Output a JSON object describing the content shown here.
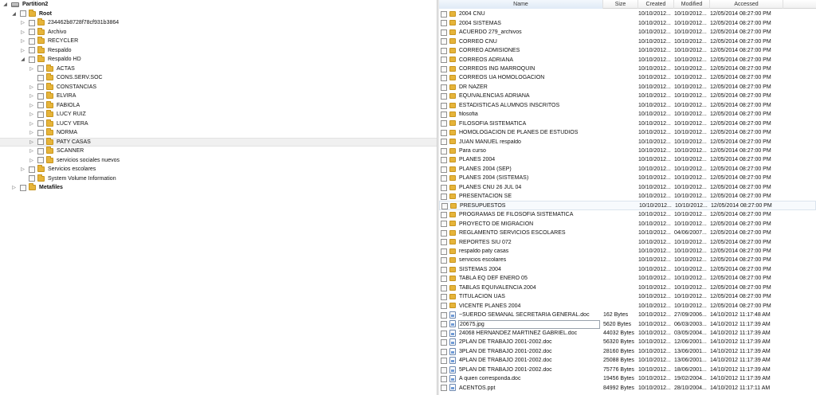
{
  "tree": [
    {
      "label": "Partition2",
      "level": 0,
      "expander": "◢",
      "icon": "drive-icon",
      "bold": true,
      "checkbox": false
    },
    {
      "label": "Root",
      "level": 1,
      "expander": "◢",
      "icon": "folder-icon",
      "bold": true
    },
    {
      "label": "234462b8728f78cf931b3864",
      "level": 2,
      "expander": "▷",
      "icon": "folder-icon"
    },
    {
      "label": "Archivo",
      "level": 2,
      "expander": "▷",
      "icon": "folder-icon"
    },
    {
      "label": "RECYCLER",
      "level": 2,
      "expander": "▷",
      "icon": "folder-icon"
    },
    {
      "label": "Respaldo",
      "level": 2,
      "expander": "▷",
      "icon": "folder-icon"
    },
    {
      "label": "Respaldo HD",
      "level": 2,
      "expander": "◢",
      "icon": "folder-icon"
    },
    {
      "label": "ACTAS",
      "level": 3,
      "expander": "▷",
      "icon": "folder-icon"
    },
    {
      "label": "CONS.SERV.SOC",
      "level": 3,
      "expander": "",
      "icon": "folder-icon"
    },
    {
      "label": "CONSTANCIAS",
      "level": 3,
      "expander": "▷",
      "icon": "folder-icon"
    },
    {
      "label": "ELVIRA",
      "level": 3,
      "expander": "▷",
      "icon": "folder-icon"
    },
    {
      "label": "FABIOLA",
      "level": 3,
      "expander": "▷",
      "icon": "folder-icon"
    },
    {
      "label": "LUCY RUIZ",
      "level": 3,
      "expander": "▷",
      "icon": "folder-icon"
    },
    {
      "label": "LUCY VERA",
      "level": 3,
      "expander": "▷",
      "icon": "folder-icon"
    },
    {
      "label": "NORMA",
      "level": 3,
      "expander": "▷",
      "icon": "folder-icon"
    },
    {
      "label": "PATY CASAS",
      "level": 3,
      "expander": "▷",
      "icon": "folder-icon",
      "selected": true
    },
    {
      "label": "SCANNER",
      "level": 3,
      "expander": "▷",
      "icon": "folder-icon"
    },
    {
      "label": "servicios sociales nuevos",
      "level": 3,
      "expander": "▷",
      "icon": "folder-icon"
    },
    {
      "label": "Servicios escolares",
      "level": 2,
      "expander": "▷",
      "icon": "folder-icon"
    },
    {
      "label": "System Volume Information",
      "level": 2,
      "expander": "",
      "icon": "folder-icon"
    },
    {
      "label": "Metafiles",
      "level": 1,
      "expander": "▷",
      "icon": "folder-icon",
      "bold": true
    }
  ],
  "list": {
    "headers": {
      "name": "Name",
      "size": "Size",
      "created": "Created",
      "modified": "Modified",
      "accessed": "Accessed"
    },
    "rows": [
      {
        "name": "2004 CNU",
        "size": "",
        "created": "10/10/2012...",
        "modified": "10/10/2012...",
        "accessed": "12/05/2014 08:27:00 PM",
        "type": "folder"
      },
      {
        "name": "2004 SISTEMAS",
        "size": "",
        "created": "10/10/2012...",
        "modified": "10/10/2012...",
        "accessed": "12/05/2014 08:27:00 PM",
        "type": "folder"
      },
      {
        "name": "ACUERDO 279_archivos",
        "size": "",
        "created": "10/10/2012...",
        "modified": "10/10/2012...",
        "accessed": "12/05/2014 08:27:00 PM",
        "type": "folder"
      },
      {
        "name": "CORREO CNU",
        "size": "",
        "created": "10/10/2012...",
        "modified": "10/10/2012...",
        "accessed": "12/05/2014 08:27:00 PM",
        "type": "folder"
      },
      {
        "name": "CORREO ADMISIONES",
        "size": "",
        "created": "10/10/2012...",
        "modified": "10/10/2012...",
        "accessed": "12/05/2014 08:27:00 PM",
        "type": "folder"
      },
      {
        "name": "CORREOS ADRIANA",
        "size": "",
        "created": "10/10/2012...",
        "modified": "10/10/2012...",
        "accessed": "12/05/2014 08:27:00 PM",
        "type": "folder"
      },
      {
        "name": "CORREOS ING MARROQUIN",
        "size": "",
        "created": "10/10/2012...",
        "modified": "10/10/2012...",
        "accessed": "12/05/2014 08:27:00 PM",
        "type": "folder"
      },
      {
        "name": "CORREOS UA HOMOLOGACION",
        "size": "",
        "created": "10/10/2012...",
        "modified": "10/10/2012...",
        "accessed": "12/05/2014 08:27:00 PM",
        "type": "folder"
      },
      {
        "name": "DR NAZER",
        "size": "",
        "created": "10/10/2012...",
        "modified": "10/10/2012...",
        "accessed": "12/05/2014 08:27:00 PM",
        "type": "folder"
      },
      {
        "name": "EQUIVALENCIAS ADRIANA",
        "size": "",
        "created": "10/10/2012...",
        "modified": "10/10/2012...",
        "accessed": "12/05/2014 08:27:00 PM",
        "type": "folder"
      },
      {
        "name": "ESTADISTICAS ALUMNOS INSCRITOS",
        "size": "",
        "created": "10/10/2012...",
        "modified": "10/10/2012...",
        "accessed": "12/05/2014 08:27:00 PM",
        "type": "folder"
      },
      {
        "name": "filosofia",
        "size": "",
        "created": "10/10/2012...",
        "modified": "10/10/2012...",
        "accessed": "12/05/2014 08:27:00 PM",
        "type": "folder"
      },
      {
        "name": "FILOSOFIA SISTEMATICA",
        "size": "",
        "created": "10/10/2012...",
        "modified": "10/10/2012...",
        "accessed": "12/05/2014 08:27:00 PM",
        "type": "folder"
      },
      {
        "name": "HOMOLOGACION DE PLANES DE ESTUDIOS",
        "size": "",
        "created": "10/10/2012...",
        "modified": "10/10/2012...",
        "accessed": "12/05/2014 08:27:00 PM",
        "type": "folder"
      },
      {
        "name": "JUAN MANUEL respaldo",
        "size": "",
        "created": "10/10/2012...",
        "modified": "10/10/2012...",
        "accessed": "12/05/2014 08:27:00 PM",
        "type": "folder"
      },
      {
        "name": "Para curso",
        "size": "",
        "created": "10/10/2012...",
        "modified": "10/10/2012...",
        "accessed": "12/05/2014 08:27:00 PM",
        "type": "folder"
      },
      {
        "name": "PLANES 2004",
        "size": "",
        "created": "10/10/2012...",
        "modified": "10/10/2012...",
        "accessed": "12/05/2014 08:27:00 PM",
        "type": "folder"
      },
      {
        "name": "PLANES 2004 (SEP)",
        "size": "",
        "created": "10/10/2012...",
        "modified": "10/10/2012...",
        "accessed": "12/05/2014 08:27:00 PM",
        "type": "folder"
      },
      {
        "name": "PLANES 2004 (SISTEMAS)",
        "size": "",
        "created": "10/10/2012...",
        "modified": "10/10/2012...",
        "accessed": "12/05/2014 08:27:00 PM",
        "type": "folder"
      },
      {
        "name": "PLANES CNU 26 JUL 04",
        "size": "",
        "created": "10/10/2012...",
        "modified": "10/10/2012...",
        "accessed": "12/05/2014 08:27:00 PM",
        "type": "folder"
      },
      {
        "name": "PRESENTACION SE",
        "size": "",
        "created": "10/10/2012...",
        "modified": "10/10/2012...",
        "accessed": "12/05/2014 08:27:00 PM",
        "type": "folder"
      },
      {
        "name": "PRESUPUESTOS",
        "size": "",
        "created": "10/10/2012...",
        "modified": "10/10/2012...",
        "accessed": "12/05/2014 08:27:00 PM",
        "type": "folder",
        "selected": true
      },
      {
        "name": "PROGRAMAS DE FILOSOFIA SISTEMATICA",
        "size": "",
        "created": "10/10/2012...",
        "modified": "10/10/2012...",
        "accessed": "12/05/2014 08:27:00 PM",
        "type": "folder"
      },
      {
        "name": "PROYECTO DE MIGRACION",
        "size": "",
        "created": "10/10/2012...",
        "modified": "10/10/2012...",
        "accessed": "12/05/2014 08:27:00 PM",
        "type": "folder"
      },
      {
        "name": "REGLAMENTO SERVICIOS ESCOLARES",
        "size": "",
        "created": "10/10/2012...",
        "modified": "04/06/2007...",
        "accessed": "12/05/2014 08:27:00 PM",
        "type": "folder"
      },
      {
        "name": "REPORTES SIU 072",
        "size": "",
        "created": "10/10/2012...",
        "modified": "10/10/2012...",
        "accessed": "12/05/2014 08:27:00 PM",
        "type": "folder"
      },
      {
        "name": "respaldo paty casas",
        "size": "",
        "created": "10/10/2012...",
        "modified": "10/10/2012...",
        "accessed": "12/05/2014 08:27:00 PM",
        "type": "folder"
      },
      {
        "name": "servicios escolares",
        "size": "",
        "created": "10/10/2012...",
        "modified": "10/10/2012...",
        "accessed": "12/05/2014 08:27:00 PM",
        "type": "folder"
      },
      {
        "name": "SISTEMAS 2004",
        "size": "",
        "created": "10/10/2012...",
        "modified": "10/10/2012...",
        "accessed": "12/05/2014 08:27:00 PM",
        "type": "folder"
      },
      {
        "name": "TABLA EQ DEF ENERO 05",
        "size": "",
        "created": "10/10/2012...",
        "modified": "10/10/2012...",
        "accessed": "12/05/2014 08:27:00 PM",
        "type": "folder"
      },
      {
        "name": "TABLAS EQUIVALENCIA 2004",
        "size": "",
        "created": "10/10/2012...",
        "modified": "10/10/2012...",
        "accessed": "12/05/2014 08:27:00 PM",
        "type": "folder"
      },
      {
        "name": "TITULACION UAS",
        "size": "",
        "created": "10/10/2012...",
        "modified": "10/10/2012...",
        "accessed": "12/05/2014 08:27:00 PM",
        "type": "folder"
      },
      {
        "name": "VICENTE PLANES 2004",
        "size": "",
        "created": "10/10/2012...",
        "modified": "10/10/2012...",
        "accessed": "12/05/2014 08:27:00 PM",
        "type": "folder"
      },
      {
        "name": "~SUERDO SEMANAL SECRETARIA GENERAL.doc",
        "size": "162 Bytes",
        "created": "10/10/2012...",
        "modified": "27/09/2006...",
        "accessed": "14/10/2012 11:17:48 AM",
        "type": "file"
      },
      {
        "name": "20675.jpg",
        "size": "5620 Bytes",
        "created": "10/10/2012...",
        "modified": "06/03/2003...",
        "accessed": "14/10/2012 11:17:39 AM",
        "type": "file",
        "boxed": true
      },
      {
        "name": "24068 HERNÁNDEZ MARTÍNEZ GABRIEL.doc",
        "size": "44032 Bytes",
        "created": "10/10/2012...",
        "modified": "03/05/2004...",
        "accessed": "14/10/2012 11:17:39 AM",
        "type": "file"
      },
      {
        "name": "2PLAN DE TRABAJO 2001-2002.doc",
        "size": "56320 Bytes",
        "created": "10/10/2012...",
        "modified": "12/06/2001...",
        "accessed": "14/10/2012 11:17:39 AM",
        "type": "file"
      },
      {
        "name": "3PLAN DE TRABAJO 2001-2002.doc",
        "size": "28160 Bytes",
        "created": "10/10/2012...",
        "modified": "13/06/2001...",
        "accessed": "14/10/2012 11:17:39 AM",
        "type": "file"
      },
      {
        "name": "4PLAN DE TRABAJO 2001-2002.doc",
        "size": "25088 Bytes",
        "created": "10/10/2012...",
        "modified": "13/06/2001...",
        "accessed": "14/10/2012 11:17:39 AM",
        "type": "file"
      },
      {
        "name": "5PLAN DE TRABAJO 2001-2002.doc",
        "size": "75776 Bytes",
        "created": "10/10/2012...",
        "modified": "18/06/2001...",
        "accessed": "14/10/2012 11:17:39 AM",
        "type": "file"
      },
      {
        "name": "A quien corresponda.doc",
        "size": "19456 Bytes",
        "created": "10/10/2012...",
        "modified": "19/02/2004...",
        "accessed": "14/10/2012 11:17:39 AM",
        "type": "file"
      },
      {
        "name": "ACENTOS.ppt",
        "size": "84992 Bytes",
        "created": "10/10/2012...",
        "modified": "28/10/2004...",
        "accessed": "14/10/2012 11:17:11 AM",
        "type": "file"
      }
    ]
  }
}
